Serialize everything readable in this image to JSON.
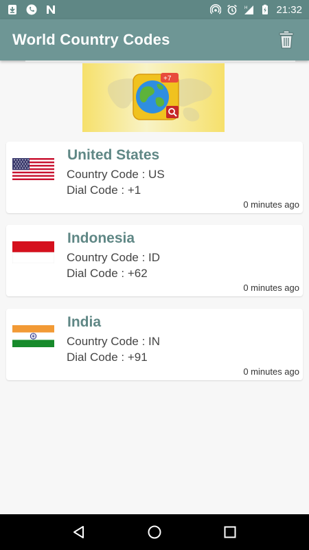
{
  "status_bar": {
    "time": "21:32",
    "left_icons": [
      "download-icon",
      "phone-icon",
      "n-icon"
    ],
    "right_icons": [
      "hotspot-icon",
      "alarm-icon",
      "signal-icon",
      "battery-icon"
    ]
  },
  "app_bar": {
    "title": "World Country Codes",
    "action_icon": "trash-icon"
  },
  "banner": {
    "badge_text": "+7"
  },
  "countries": [
    {
      "name": "United States",
      "country_code": "Country Code : US",
      "dial_code": "Dial Code : +1",
      "timestamp": "0 minutes ago",
      "flag": "us-flag"
    },
    {
      "name": "Indonesia",
      "country_code": "Country Code : ID",
      "dial_code": "Dial Code : +62",
      "timestamp": "0 minutes ago",
      "flag": "id-flag"
    },
    {
      "name": "India",
      "country_code": "Country Code : IN",
      "dial_code": "Dial Code : +91",
      "timestamp": "0 minutes ago",
      "flag": "in-flag"
    }
  ],
  "nav_bar": {
    "buttons": [
      "back-icon",
      "home-icon",
      "recents-icon"
    ]
  },
  "colors": {
    "app_bar": "#6e9695",
    "status_bar": "#5f8785",
    "country_name": "#5f8785"
  }
}
